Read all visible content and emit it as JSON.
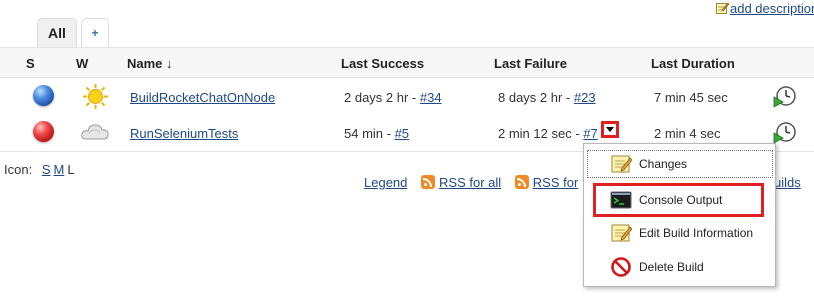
{
  "header": {
    "add_description_label": "add description"
  },
  "tabs": {
    "all_label": "All",
    "add_label": "+"
  },
  "table": {
    "columns": {
      "s": "S",
      "w": "W",
      "name": "Name",
      "name_sort": "↓",
      "last_success": "Last Success",
      "last_failure": "Last Failure",
      "last_duration": "Last Duration"
    },
    "rows": [
      {
        "status": "blue",
        "weather": "sunny",
        "name": "BuildRocketChatOnNode",
        "last_success_time": "2 days 2 hr - ",
        "last_success_build": "#34",
        "last_failure_time": "8 days 2 hr - ",
        "last_failure_build": "#23",
        "last_duration": "7 min 45 sec"
      },
      {
        "status": "red",
        "weather": "cloudy",
        "name": "RunSeleniumTests",
        "last_success_time": "54 min - ",
        "last_success_build": "#5",
        "last_failure_time": "2 min 12 sec - ",
        "last_failure_build": "#7",
        "last_duration": "2 min 4 sec"
      }
    ]
  },
  "icon_size": {
    "label": "Icon:",
    "small": "S",
    "medium": "M",
    "large": "L"
  },
  "footer": {
    "legend": "Legend",
    "rss_all": "RSS for all",
    "rss_failures": "RSS for",
    "builds_fragment": "uilds"
  },
  "menu": {
    "items": [
      {
        "label": "Changes",
        "icon": "notepad-icon"
      },
      {
        "label": "Console Output",
        "icon": "terminal-icon"
      },
      {
        "label": "Edit Build Information",
        "icon": "notepad-icon"
      },
      {
        "label": "Delete Build",
        "icon": "no-entry-icon"
      }
    ]
  },
  "colors": {
    "highlight": "#e02020",
    "link": "#204a87",
    "success_ball": "#1d4fa8",
    "failure_ball": "#b81414",
    "rss": "#f08a24"
  }
}
